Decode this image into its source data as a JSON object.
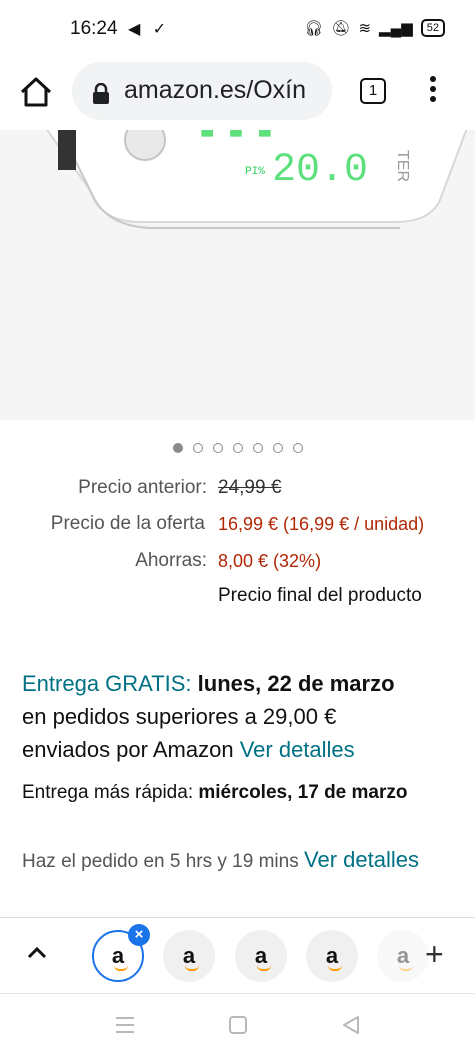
{
  "status_bar": {
    "time": "16:24",
    "battery": "52"
  },
  "browser": {
    "url": "amazon.es/Oxín",
    "tab_count": "1"
  },
  "product_image": {
    "display_pi_label": "PI%",
    "display_pi_value": "20.0",
    "brand_partial": "TER"
  },
  "carousel": {
    "dots": 7,
    "active": 0
  },
  "price": {
    "old_label": "Precio anterior:",
    "old_value": "24,99 €",
    "offer_label": "Precio de la oferta",
    "offer_value": "16,99 € (16,99 € / unidad)",
    "savings_label": "Ahorras:",
    "savings_value": "8,00 € (32%)",
    "final_note": "Precio final del producto"
  },
  "delivery": {
    "free_label": "Entrega GRATIS:",
    "free_date": "lunes, 22 de marzo",
    "line2": "en pedidos superiores a 29,00 €",
    "line3": "enviados por Amazon",
    "details_link": "Ver detalles",
    "fast_label": "Entrega más rápida:",
    "fast_date": "miércoles, 17 de marzo",
    "order_within": "Haz el pedido en 5 hrs y 19 mins",
    "details_link2": "Ver detalles"
  },
  "tab_strip": {
    "tab_letter": "a"
  },
  "colors": {
    "accent_teal": "#007185",
    "price_red": "#b12704",
    "chrome_blue": "#1a73e8"
  }
}
